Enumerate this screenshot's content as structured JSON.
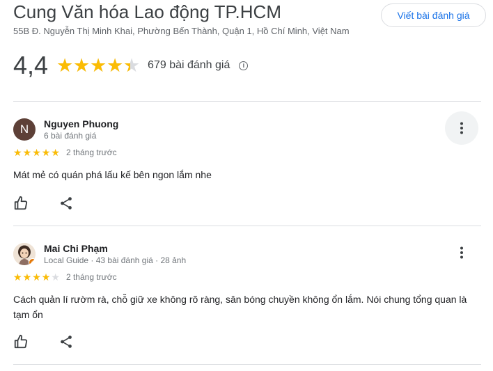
{
  "place": {
    "name": "Cung Văn hóa Lao động TP.HCM",
    "address": "55B Đ. Nguyễn Thị Minh Khai, Phường Bến Thành, Quận 1, Hồ Chí Minh, Việt Nam",
    "write_review_label": "Viết bài đánh giá",
    "rating_text": "4,4",
    "rating_value": 4.4,
    "review_count": "679 bài đánh giá",
    "star_color": "#fbbc04"
  },
  "reviews": [
    {
      "author": "Nguyen Phuong",
      "avatar_initial": "N",
      "meta": "6 bài đánh giá",
      "stars": 5,
      "date": "2 tháng trước",
      "text": "Mát mẻ có quán phá lấu kế bên ngon lắm nhe",
      "avatar_color": "#5d4037"
    },
    {
      "author": "Mai Chi Phạm",
      "meta": "Local Guide · 43 bài đánh giá · 28 ảnh",
      "stars": 4,
      "date": "2 tháng trước",
      "text": "Cách quản lí rườm rà, chỗ giữ xe không rõ ràng, sân bóng chuyền không ổn lắm. Nói chung tổng quan là tạm ổn"
    }
  ],
  "icons": {
    "info": "info-icon",
    "like": "thumb-up-icon",
    "share": "share-icon",
    "more": "more-vert-icon",
    "local_guide": "local-guide-badge-icon"
  }
}
